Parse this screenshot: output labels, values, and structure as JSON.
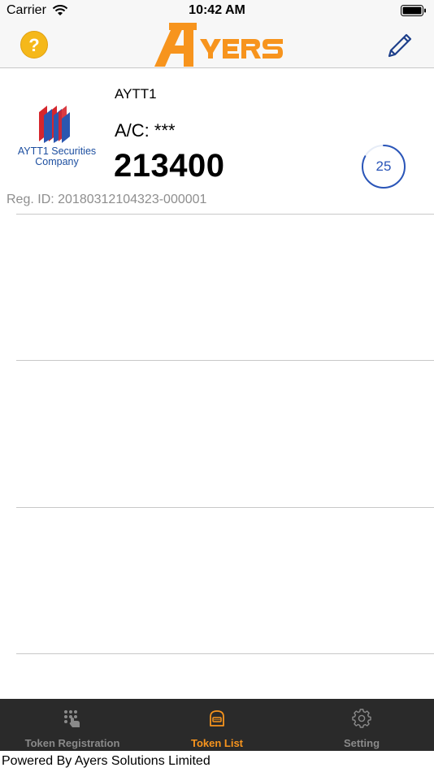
{
  "status_bar": {
    "carrier": "Carrier",
    "time": "10:42 AM"
  },
  "nav": {
    "help_symbol": "?",
    "logo_icon": "ayers-logo",
    "edit_icon": "pencil-icon"
  },
  "token": {
    "company_name_line1": "AYTT1 Securities",
    "company_name_line2": "Company",
    "name": "AYTT1",
    "account": "A/C: ***",
    "code": "213400",
    "countdown": "25",
    "countdown_fraction": 0.83,
    "reg_id": "Reg. ID: 20180312104323-000001"
  },
  "tabs": [
    {
      "label": "Token Registration",
      "icon": "keypad-touch-icon",
      "active": false
    },
    {
      "label": "Token List",
      "icon": "token-device-icon",
      "active": true
    },
    {
      "label": "Setting",
      "icon": "gear-icon",
      "active": false
    }
  ],
  "footer": {
    "text": "Powered By Ayers Solutions Limited"
  },
  "colors": {
    "accent_orange": "#f7941d",
    "logo_blue": "#1d4fa0",
    "timer_blue": "#2a55b8",
    "help_yellow": "#f5b81a",
    "tab_bar_bg": "#2a2a2a"
  }
}
